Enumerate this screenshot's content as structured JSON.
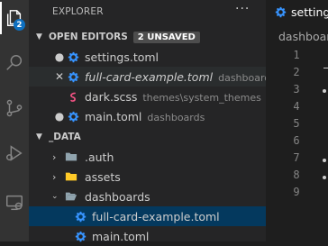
{
  "activity_bar": {
    "items": [
      {
        "name": "explorer",
        "badge": "2"
      },
      {
        "name": "search"
      },
      {
        "name": "source-control"
      },
      {
        "name": "run-and-debug"
      },
      {
        "name": "remote-explorer"
      }
    ]
  },
  "sidebar": {
    "title": "EXPLORER",
    "more_label": "···",
    "open_editors": {
      "header": "OPEN EDITORS",
      "unsaved_badge": "2 UNSAVED",
      "items": [
        {
          "marker": "●",
          "icon": "gear-icon",
          "name": "settings.toml",
          "description": "",
          "italic": false
        },
        {
          "marker": "✕",
          "icon": "gear-icon",
          "name": "full-card-example.toml",
          "description": "dashboards",
          "italic": true
        },
        {
          "marker": "",
          "icon": "sass-icon",
          "name": "dark.scss",
          "description": "themes\\system_themes",
          "italic": false
        },
        {
          "marker": "●",
          "icon": "gear-icon",
          "name": "main.toml",
          "description": "dashboards",
          "italic": false
        }
      ]
    },
    "folder": {
      "header": "_DATA",
      "items": [
        {
          "type": "folder",
          "expanded": false,
          "name": ".auth"
        },
        {
          "type": "folder",
          "expanded": false,
          "name": "assets"
        },
        {
          "type": "folder",
          "expanded": true,
          "name": "dashboards"
        },
        {
          "type": "file",
          "icon": "gear-icon",
          "name": "full-card-example.toml"
        },
        {
          "type": "file",
          "icon": "gear-icon",
          "name": "main.toml"
        }
      ]
    }
  },
  "editor": {
    "tab_label": "settings",
    "breadcrumb": "dashboard",
    "line_numbers": [
      "1",
      "2",
      "3",
      "4",
      "5",
      "6",
      "7",
      "8",
      "9"
    ]
  },
  "colors": {
    "accent": "#0e70c0",
    "gear_icon": "#3794ff",
    "sass_icon": "#f55385",
    "selected_row": "#04395e"
  }
}
